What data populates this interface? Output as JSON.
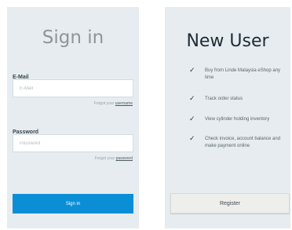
{
  "signin": {
    "title": "Sign in",
    "email_label": "E-Mail",
    "email_placeholder": "E-Mail",
    "forgot_email_prefix": "Forgot your",
    "forgot_email_link": "username",
    "password_label": "Password",
    "password_placeholder": "Password",
    "forgot_password_prefix": "Forgot your",
    "forgot_password_link": "password",
    "button_label": "Sign in"
  },
  "new_user": {
    "title": "New User",
    "benefits": [
      {
        "icon": "check-icon",
        "text": "Buy from Linde Malaysia eShop any time"
      },
      {
        "icon": "check-icon",
        "text": "Track order status"
      },
      {
        "icon": "check-icon",
        "text": "View cylinder holding inventory"
      },
      {
        "icon": "check-icon",
        "text": "Check invoice, account balance and make payment online"
      }
    ],
    "register_label": "Register"
  }
}
